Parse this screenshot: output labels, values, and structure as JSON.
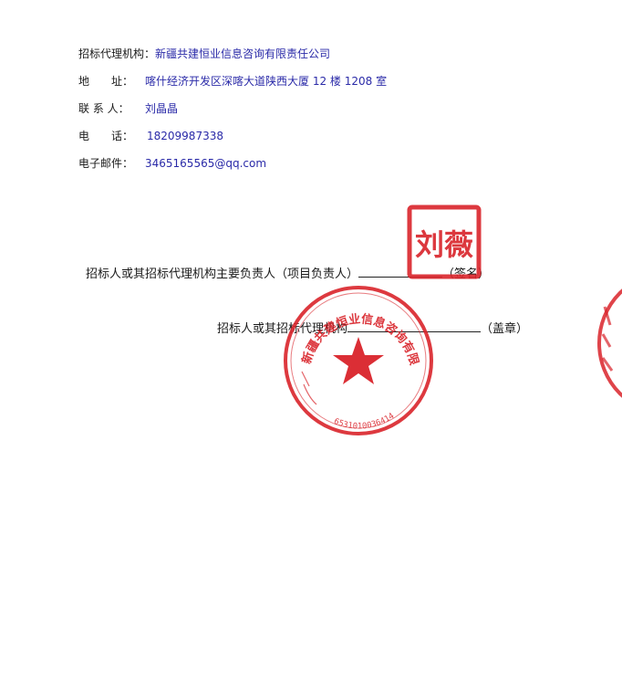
{
  "agency_info": {
    "agency": {
      "label": "招标代理机构：",
      "value": "新疆共建恒业信息咨询有限责任公司"
    },
    "address": {
      "label": "地　　址：",
      "value": "喀什经济开发区深喀大道陕西大厦 12 楼 1208 室"
    },
    "contact": {
      "label": "联 系 人：",
      "value": "刘晶晶"
    },
    "phone": {
      "label": "电　　话：",
      "value": "18209987338"
    },
    "email": {
      "label": "电子邮件：",
      "value": "3465165565@qq.com"
    }
  },
  "signatures": {
    "line1": {
      "text": "招标人或其招标代理机构主要负责人（项目负责人）",
      "suffix": "（签名）"
    },
    "line2": {
      "text": "招标人或其招标代理机构",
      "suffix": "（盖章）"
    }
  },
  "stamps": {
    "name_seal": "刘薇",
    "company_seal_name": "新疆共建恒业信息咨询有限责任公司",
    "company_seal_code": "6531010036414",
    "color": "#d9232a"
  }
}
